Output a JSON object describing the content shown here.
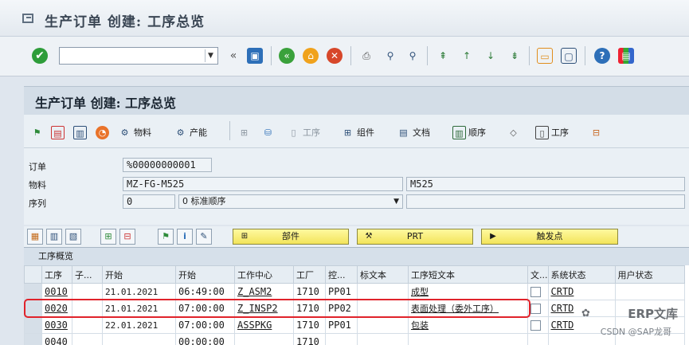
{
  "window": {
    "title": "生产订单 创建: 工序总览"
  },
  "toolbar": {
    "command_value": "",
    "icons": [
      "ok-icon",
      "save-icon",
      "back-icon",
      "exit-icon",
      "cancel-icon",
      "print-icon",
      "find-icon",
      "find-next-icon",
      "first-page-icon",
      "prev-page-icon",
      "next-page-icon",
      "last-page-icon",
      "new-session-icon",
      "shortcut-icon",
      "help-icon",
      "layout-icon"
    ]
  },
  "panel": {
    "title": "生产订单 创建: 工序总览"
  },
  "app_toolbar": {
    "material": "物料",
    "capacity": "产能",
    "operation_disabled": "工序",
    "component": "组件",
    "document": "文档",
    "sequence": "顺序",
    "operation": "工序"
  },
  "header": {
    "order_label": "订单",
    "order_value": "%00000000001",
    "material_label": "物料",
    "material_value": "MZ-FG-M525",
    "material_desc": "M525",
    "sequence_label": "序列",
    "sequence_value": "0",
    "sequence_type": "0 标准顺序"
  },
  "tabs": {
    "components": "部件",
    "prt": "PRT",
    "trigger_points": "触发点"
  },
  "table": {
    "caption": "工序概览",
    "columns": [
      "工序",
      "子...",
      "开始",
      "开始",
      "工作中心",
      "工厂",
      "控...",
      "标文本",
      "工序短文本",
      "文...",
      "系统状态",
      "用户状态"
    ],
    "rows": [
      {
        "op": "0010",
        "sub": "",
        "start_date": "21.01.2021",
        "start_time": "06:49:00",
        "wc": "Z_ASM2",
        "plant": "1710",
        "ctrl": "PP01",
        "std": "",
        "text": "成型",
        "status": "CRTD",
        "user": ""
      },
      {
        "op": "0020",
        "sub": "",
        "start_date": "21.01.2021",
        "start_time": "07:00:00",
        "wc": "Z_INSP2",
        "plant": "1710",
        "ctrl": "PP02",
        "std": "",
        "text": "表面处理（委外工序）",
        "status": "CRTD",
        "user": ""
      },
      {
        "op": "0030",
        "sub": "",
        "start_date": "22.01.2021",
        "start_time": "07:00:00",
        "wc": "ASSPKG",
        "plant": "1710",
        "ctrl": "PP01",
        "std": "",
        "text": "包装",
        "status": "CRTD",
        "user": ""
      },
      {
        "op": "0040",
        "sub": "",
        "start_date": "",
        "start_time": "00:00:00",
        "wc": "",
        "plant": "1710",
        "ctrl": "",
        "std": "",
        "text": "",
        "status": "",
        "user": ""
      }
    ]
  },
  "watermark": {
    "brand": "ERP文库",
    "credit": "CSDN @SAP龙哥"
  }
}
